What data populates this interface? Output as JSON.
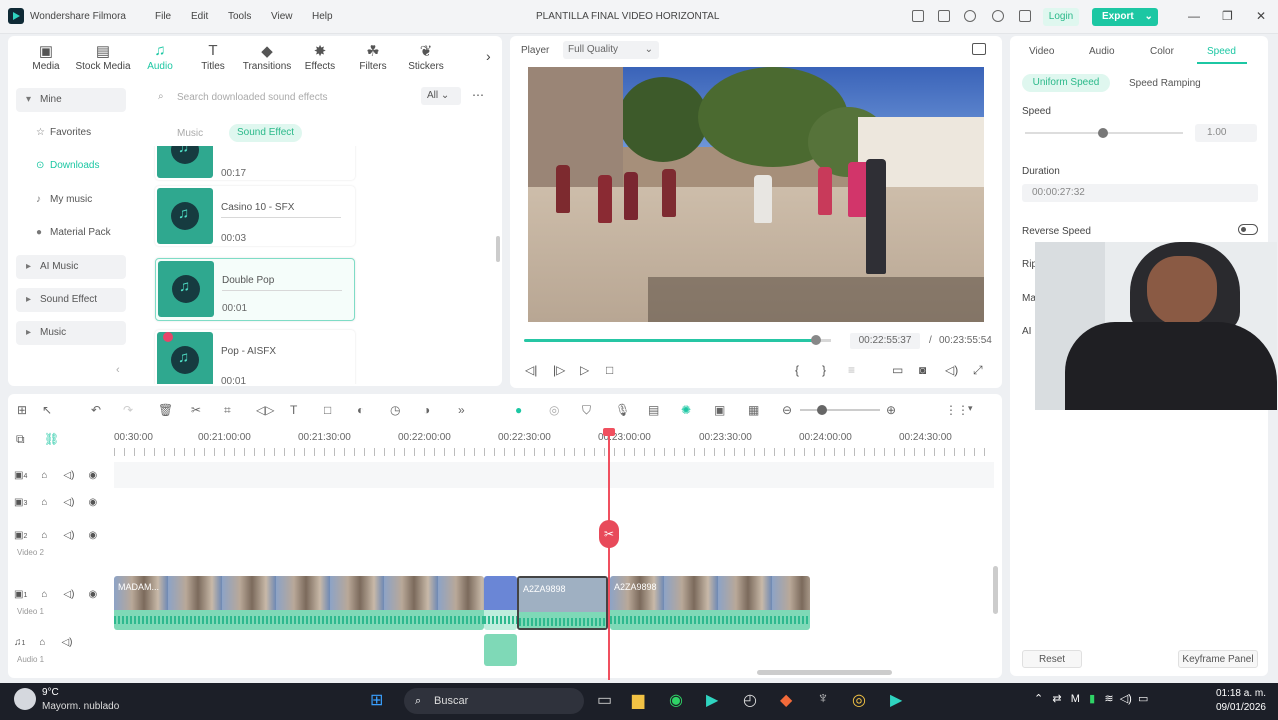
{
  "titlebar": {
    "app_name": "Wondershare Filmora",
    "menu": [
      "File",
      "Edit",
      "Tools",
      "View",
      "Help"
    ],
    "project_title": "PLANTILLA FINAL VIDEO HORIZONTAL",
    "login_label": "Login",
    "export_label": "Export"
  },
  "nav_tabs": [
    {
      "label": "Media",
      "icon": "media-icon"
    },
    {
      "label": "Stock Media",
      "icon": "stock-media-icon"
    },
    {
      "label": "Audio",
      "icon": "audio-icon"
    },
    {
      "label": "Titles",
      "icon": "titles-icon"
    },
    {
      "label": "Transitions",
      "icon": "transitions-icon"
    },
    {
      "label": "Effects",
      "icon": "effects-icon"
    },
    {
      "label": "Filters",
      "icon": "filters-icon"
    },
    {
      "label": "Stickers",
      "icon": "stickers-icon"
    }
  ],
  "sidebar": {
    "mine": "Mine",
    "favorites": "Favorites",
    "downloads": "Downloads",
    "my_music": "My music",
    "material_pack": "Material Pack",
    "ai_music": "AI Music",
    "sound_effect": "Sound Effect",
    "music": "Music"
  },
  "library": {
    "search_placeholder": "Search downloaded sound effects",
    "filter": "All",
    "tab_music": "Music",
    "tab_sound_effect": "Sound Effect",
    "items": [
      {
        "name": "",
        "duration": "00:17"
      },
      {
        "name": "Casino 10 - SFX",
        "duration": "00:03"
      },
      {
        "name": "Double Pop",
        "duration": "00:01"
      },
      {
        "name": "Pop - AISFX",
        "duration": "00:01"
      }
    ]
  },
  "player": {
    "label": "Player",
    "quality": "Full Quality",
    "current_time": "00:22:55:37",
    "separator": "/",
    "total_time": "00:23:55:54",
    "progress": 0.9
  },
  "right_panel": {
    "tabs": [
      "Video",
      "Audio",
      "Color",
      "Speed"
    ],
    "uniform_speed": "Uniform Speed",
    "speed_ramping": "Speed Ramping",
    "speed_label": "Speed",
    "speed_value": "1.00",
    "duration_label": "Duration",
    "duration_value": "00:00:27:32",
    "reverse_label": "Reverse Speed",
    "partial_labels": [
      "Rip",
      "Ma",
      "AI"
    ],
    "reset_label": "Reset",
    "keyframe_label": "Keyframe Panel"
  },
  "timeline": {
    "ruler": [
      "00:30:00",
      "00:21:00:00",
      "00:21:30:00",
      "00:22:00:00",
      "00:22:30:00",
      "00:23:00:00",
      "00:23:30:00",
      "00:24:00:00",
      "00:24:30:00"
    ],
    "tracks": [
      {
        "num": "4",
        "name": ""
      },
      {
        "num": "3",
        "name": ""
      },
      {
        "num": "2",
        "name": "Video 2"
      },
      {
        "num": "1",
        "name": "Video 1"
      },
      {
        "num": "1",
        "name": "Audio 1"
      }
    ],
    "clips": [
      {
        "name": "MADAM..."
      },
      {
        "name": ""
      },
      {
        "name": "A2ZA9898"
      },
      {
        "name": "A2ZA9898"
      }
    ]
  },
  "taskbar": {
    "temperature": "9°C",
    "weather": "Mayorm. nublado",
    "search_label": "Buscar",
    "time": "01:18 a. m.",
    "date": "09/01/2026"
  }
}
